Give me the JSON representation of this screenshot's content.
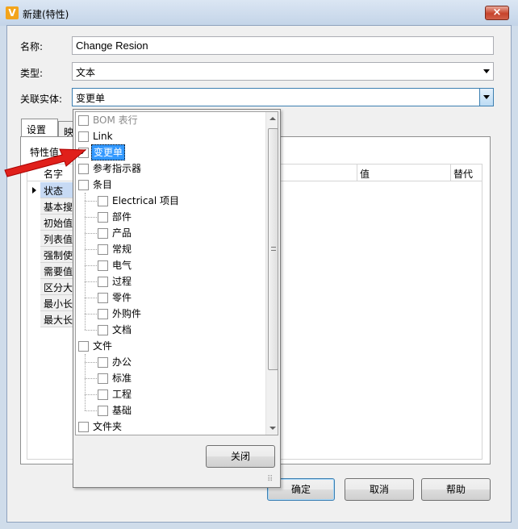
{
  "window": {
    "title": "新建(特性)",
    "close_glyph": "×",
    "app_icon_letter": "V"
  },
  "form": {
    "name_label": "名称:",
    "name_value": "Change Resion",
    "type_label": "类型:",
    "type_value": "文本",
    "entity_label": "关联实体:",
    "entity_value": "变更单"
  },
  "tabs": [
    {
      "label": "设置"
    },
    {
      "label": "映"
    }
  ],
  "grid": {
    "toolbar_label": "特性值",
    "headers": [
      "名字",
      "值",
      "替代"
    ],
    "rows": [
      "状态",
      "基本搜",
      "初始值",
      "列表值",
      "强制使",
      "需要值",
      "区分大",
      "最小长",
      "最大长"
    ]
  },
  "buttons": {
    "ok": "确定",
    "cancel": "取消",
    "help": "帮助"
  },
  "popup": {
    "close_label": "关闭",
    "items": [
      {
        "label": "BOM 表行",
        "checked": false,
        "disabled": true
      },
      {
        "label": "Link",
        "checked": false,
        "disabled": false
      },
      {
        "label": "变更单",
        "checked": true,
        "selected": true
      },
      {
        "label": "参考指示器",
        "checked": false
      },
      {
        "label": "条目",
        "checked": false
      },
      {
        "label": "Electrical 项目",
        "checked": false
      },
      {
        "label": "部件",
        "checked": false
      },
      {
        "label": "产品",
        "checked": false
      },
      {
        "label": "常规",
        "checked": false
      },
      {
        "label": "电气",
        "checked": false
      },
      {
        "label": "过程",
        "checked": false
      },
      {
        "label": "零件",
        "checked": false
      },
      {
        "label": "外购件",
        "checked": false
      },
      {
        "label": "文档",
        "checked": false
      },
      {
        "label": "文件",
        "checked": false
      },
      {
        "label": "办公",
        "checked": false
      },
      {
        "label": "标准",
        "checked": false
      },
      {
        "label": "工程",
        "checked": false
      },
      {
        "label": "基础",
        "checked": false
      },
      {
        "label": "文件夹",
        "checked": false
      }
    ]
  },
  "colors": {
    "selection": "#3399ff",
    "annotation_arrow": "#e0201b",
    "title_bar": "#c3d4e8"
  }
}
